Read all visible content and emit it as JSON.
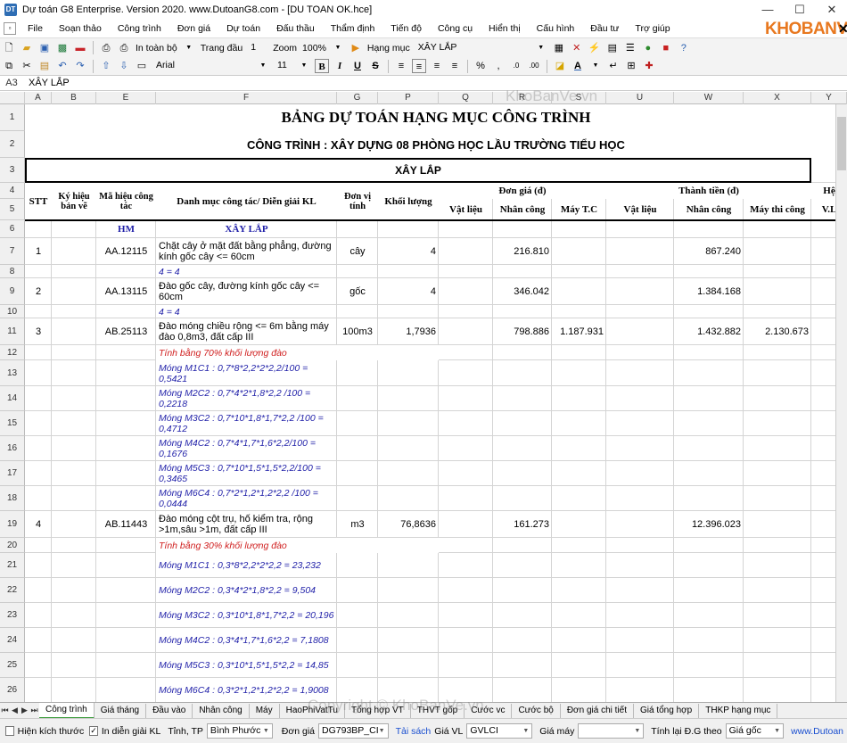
{
  "window": {
    "title": "Dự toán G8 Enterprise. Version 2020.  www.DutoanG8.com - [DU TOAN OK.hce]",
    "min": "—",
    "max": "☐",
    "close": "✕"
  },
  "logo": {
    "text": "KHOBANVE",
    "close": "✕"
  },
  "menu": [
    "File",
    "Soạn thảo",
    "Công trình",
    "Đơn giá",
    "Dự toán",
    "Đấu thầu",
    "Thẩm định",
    "Tiến độ",
    "Công cụ",
    "Hiển thị",
    "Cấu hình",
    "Đầu tư",
    "Trợ giúp"
  ],
  "toolbar1": {
    "print_scope": "In toàn bộ",
    "page_label": "Trang đầu",
    "page_value": "1",
    "zoom_label": "Zoom",
    "zoom_value": "100%",
    "category_label": "Hạng mục",
    "category_value": "XÂY LẮP"
  },
  "toolbar2": {
    "font": "Arial",
    "size": "11",
    "bold": "B",
    "italic": "I",
    "underline": "U",
    "strike": "S",
    "percent": "%",
    "comma": ","
  },
  "formula_bar": {
    "ref": "A3",
    "value": "XÂY LẮP"
  },
  "columns": [
    "A",
    "B",
    "E",
    "F",
    "G",
    "P",
    "Q",
    "R",
    "S",
    "U",
    "W",
    "X",
    "Y"
  ],
  "rows": [
    "1",
    "2",
    "3",
    "4",
    "5",
    "6",
    "7",
    "8",
    "9",
    "10",
    "11",
    "12",
    "13",
    "14",
    "15",
    "16",
    "17",
    "18",
    "19",
    "20",
    "21",
    "22",
    "23",
    "24",
    "25",
    "26"
  ],
  "sheet": {
    "title": "BẢNG DỰ TOÁN HẠNG MỤC CÔNG TRÌNH",
    "subtitle": "CÔNG TRÌNH : XÂY DỰNG 08 PHÒNG HỌC LẦU TRƯỜNG TIỂU HỌC",
    "section": "XÂY LẮP",
    "headers": {
      "stt": "STT",
      "kyhieu": "Ký hiệu bản vẽ",
      "mahieu": "Mã hiệu công tác",
      "danhmuc": "Danh mục công tác/ Diễn giải KL",
      "donvi": "Đơn vị tính",
      "khoiluong": "Khối lượng",
      "dongia": "Đơn giá (đ)",
      "thanhtien": "Thành tiền (đ)",
      "vatlieu": "Vật liệu",
      "nhancong": "Nhân công",
      "maytc": "Máy T.C",
      "vatlieu2": "Vật liệu",
      "nhancong2": "Nhân công",
      "maythicong": "Máy thi công",
      "he": "Hệ",
      "vl": "V.L"
    },
    "hm_label": "HM",
    "xaylap_label": "XÂY LẮP",
    "items": [
      {
        "row": "7",
        "stt": "1",
        "code": "AA.12115",
        "desc": "Chặt cây ở mặt đất bằng phẳng, đường kính gốc cây <= 60cm",
        "unit": "cây",
        "qty": "4",
        "nc": "216.810",
        "may": "",
        "tt_nc": "867.240",
        "tt_may": ""
      },
      {
        "row": "8",
        "note": "4 = 4"
      },
      {
        "row": "9",
        "stt": "2",
        "code": "AA.13115",
        "desc": "Đào gốc cây, đường kính gốc cây <= 60cm",
        "unit": "gốc",
        "qty": "4",
        "nc": "346.042",
        "may": "",
        "tt_nc": "1.384.168",
        "tt_may": ""
      },
      {
        "row": "10",
        "note": "4 = 4"
      },
      {
        "row": "11",
        "stt": "3",
        "code": "AB.25113",
        "desc": "Đào móng chiều rộng <= 6m bằng máy đào 0,8m3, đất cấp III",
        "unit": "100m3",
        "qty": "1,7936",
        "nc": "798.886",
        "may": "1.187.931",
        "tt_nc": "1.432.882",
        "tt_may": "2.130.673"
      },
      {
        "row": "12",
        "red": "Tính bằng 70% khối lượng đào"
      },
      {
        "row": "13",
        "note": "Móng M1C1 : 0,7*8*2,2*2*2,2/100 = 0,5421"
      },
      {
        "row": "14",
        "note": "Móng M2C2 : 0,7*4*2*1,8*2,2 /100 = 0,2218"
      },
      {
        "row": "15",
        "note": "Móng M3C2 : 0,7*10*1,8*1,7*2,2 /100 = 0,4712"
      },
      {
        "row": "16",
        "note": "Móng M4C2 : 0,7*4*1,7*1,6*2,2/100 = 0,1676"
      },
      {
        "row": "17",
        "note": "Móng M5C3 : 0,7*10*1,5*1,5*2,2/100 = 0,3465"
      },
      {
        "row": "18",
        "note": "Móng M6C4 : 0,7*2*1,2*1,2*2,2 /100 = 0,0444"
      },
      {
        "row": "19",
        "stt": "4",
        "code": "AB.11443",
        "desc": "Đào móng cột trụ, hố kiểm tra, rộng >1m,sâu >1m, đất cấp III",
        "unit": "m3",
        "qty": "76,8636",
        "nc": "161.273",
        "may": "",
        "tt_nc": "12.396.023",
        "tt_may": ""
      },
      {
        "row": "20",
        "red": "Tính bằng 30% khối lượng đào"
      },
      {
        "row": "21",
        "note": "Móng M1C1 : 0,3*8*2,2*2*2,2 = 23,232"
      },
      {
        "row": "22",
        "note": "Móng M2C2 : 0,3*4*2*1,8*2,2 = 9,504"
      },
      {
        "row": "23",
        "note": "Móng M3C2 : 0,3*10*1,8*1,7*2,2 = 20,196"
      },
      {
        "row": "24",
        "note": "Móng M4C2 : 0,3*4*1,7*1,6*2,2 = 7,1808"
      },
      {
        "row": "25",
        "note": "Móng M5C3 : 0,3*10*1,5*1,5*2,2 = 14,85"
      },
      {
        "row": "26",
        "note": "Móng M6C4 : 0,3*2*1,2*1,2*2,2 = 1,9008"
      }
    ]
  },
  "sheet_tabs": [
    "Công trình",
    "Giá tháng",
    "Đầu vào",
    "Nhân công",
    "Máy",
    "HaoPhiVatTu",
    "Tổng hợp VT",
    "THVT gốp",
    "Cước vc",
    "Cước bộ",
    "Đơn giá chi tiết",
    "Giá tổng hợp",
    "THKP hạng mục"
  ],
  "status": {
    "hien_kich_thuoc": "Hiện kích thước",
    "in_dien_giai": "In diễn giải KL",
    "tinh_label": "Tỉnh, TP",
    "tinh_value": "Bình Phước",
    "dongia_label": "Đơn giá",
    "dongia_value": "DG793BP_CI",
    "tai_sach": "Tải sách",
    "giavl_label": "Giá VL",
    "giavl_value": "GVLCI",
    "giamay_label": "Giá máy",
    "giamay_value": "",
    "tinhlai_label": "Tính lại Đ.G theo",
    "tinhlai_value": "Giá gốc",
    "link": "www.Dutoan"
  },
  "watermark": {
    "top": "KhoBanVe.vn",
    "bottom": "Copyright © KhoBanVe.vn"
  }
}
